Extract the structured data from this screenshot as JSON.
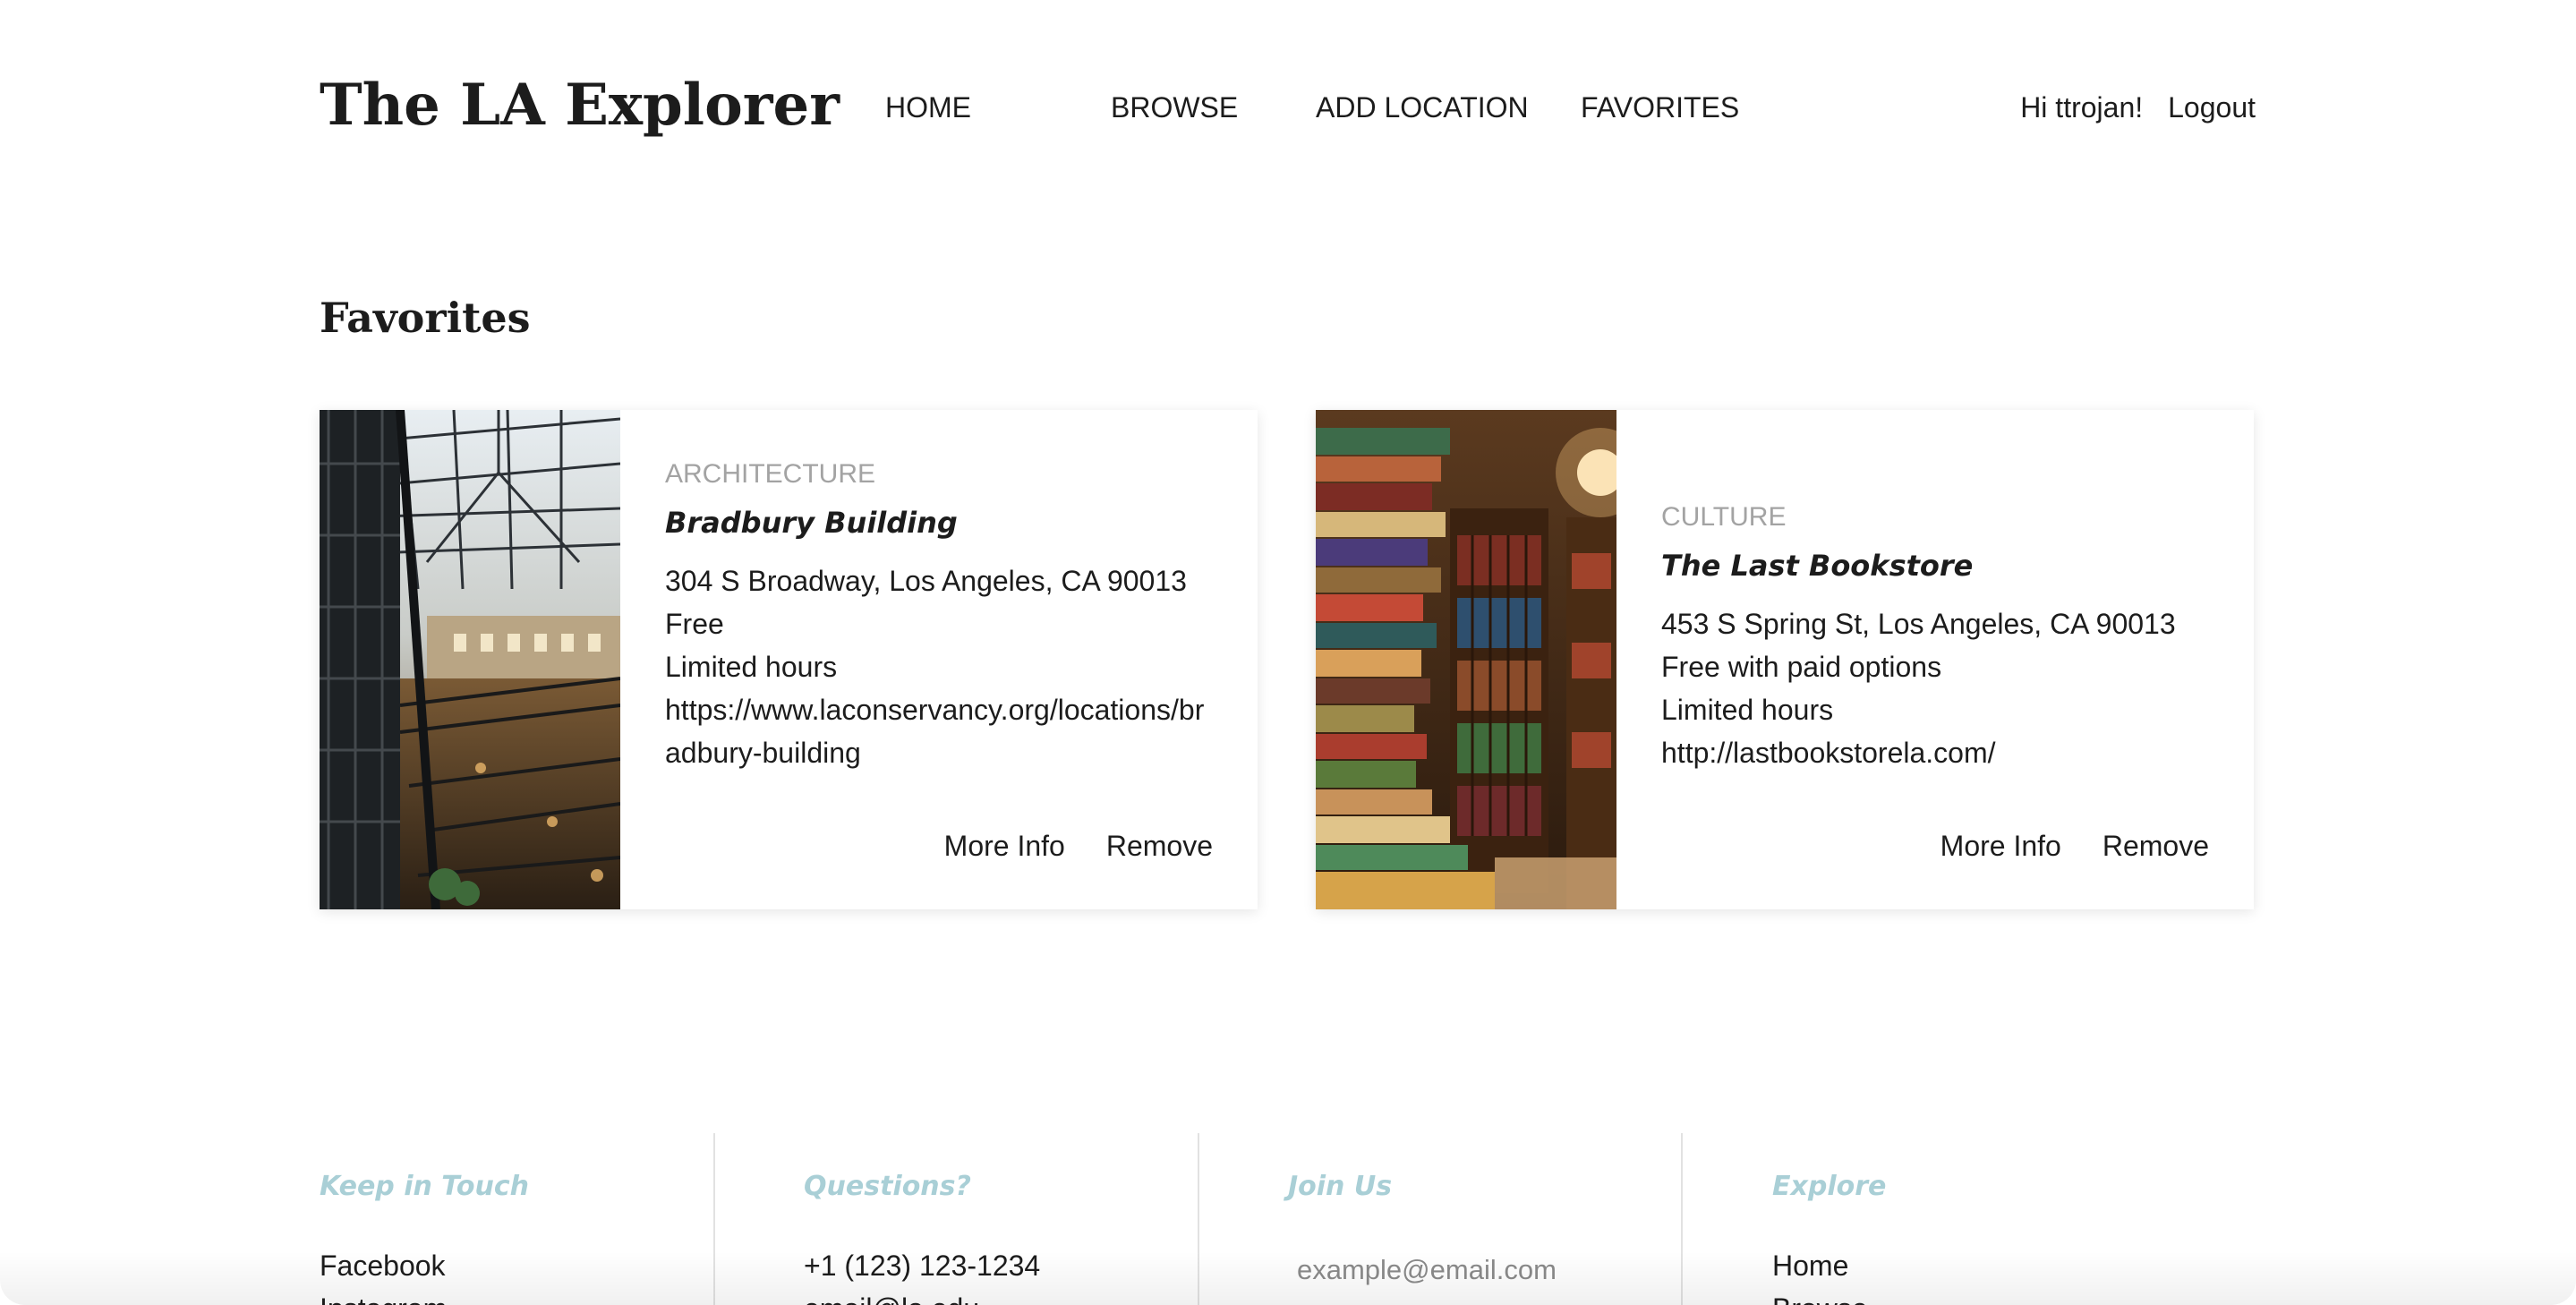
{
  "header": {
    "brand": "The LA Explorer",
    "nav": [
      {
        "label": "HOME"
      },
      {
        "label": "BROWSE"
      },
      {
        "label": "ADD LOCATION"
      },
      {
        "label": "FAVORITES"
      }
    ],
    "greeting": "Hi ttrojan!",
    "logout_label": "Logout"
  },
  "main": {
    "section_title": "Favorites",
    "cards": [
      {
        "category": "ARCHITECTURE",
        "name": "Bradbury Building",
        "address": "304 S Broadway, Los Angeles, CA 90013",
        "price": "Free",
        "hours": "Limited hours",
        "url": "https://www.laconservancy.org/locations/bradbury-building",
        "more_info_label": "More Info",
        "remove_label": "Remove"
      },
      {
        "category": "CULTURE",
        "name": "The Last Bookstore",
        "address": "453 S Spring St, Los Angeles, CA 90013",
        "price": "Free with paid options",
        "hours": "Limited hours",
        "url": "http://lastbookstorela.com/",
        "more_info_label": "More Info",
        "remove_label": "Remove"
      }
    ]
  },
  "footer": {
    "columns": [
      {
        "heading": "Keep in Touch",
        "items": [
          "Facebook",
          "Instagram"
        ]
      },
      {
        "heading": "Questions?",
        "items": [
          "+1 (123) 123-1234",
          "email@la.edu"
        ]
      },
      {
        "heading": "Join Us",
        "email_placeholder": "example@email.com"
      },
      {
        "heading": "Explore",
        "items": [
          "Home",
          "Browse"
        ]
      }
    ],
    "heading_color": "#a9cfd6"
  }
}
